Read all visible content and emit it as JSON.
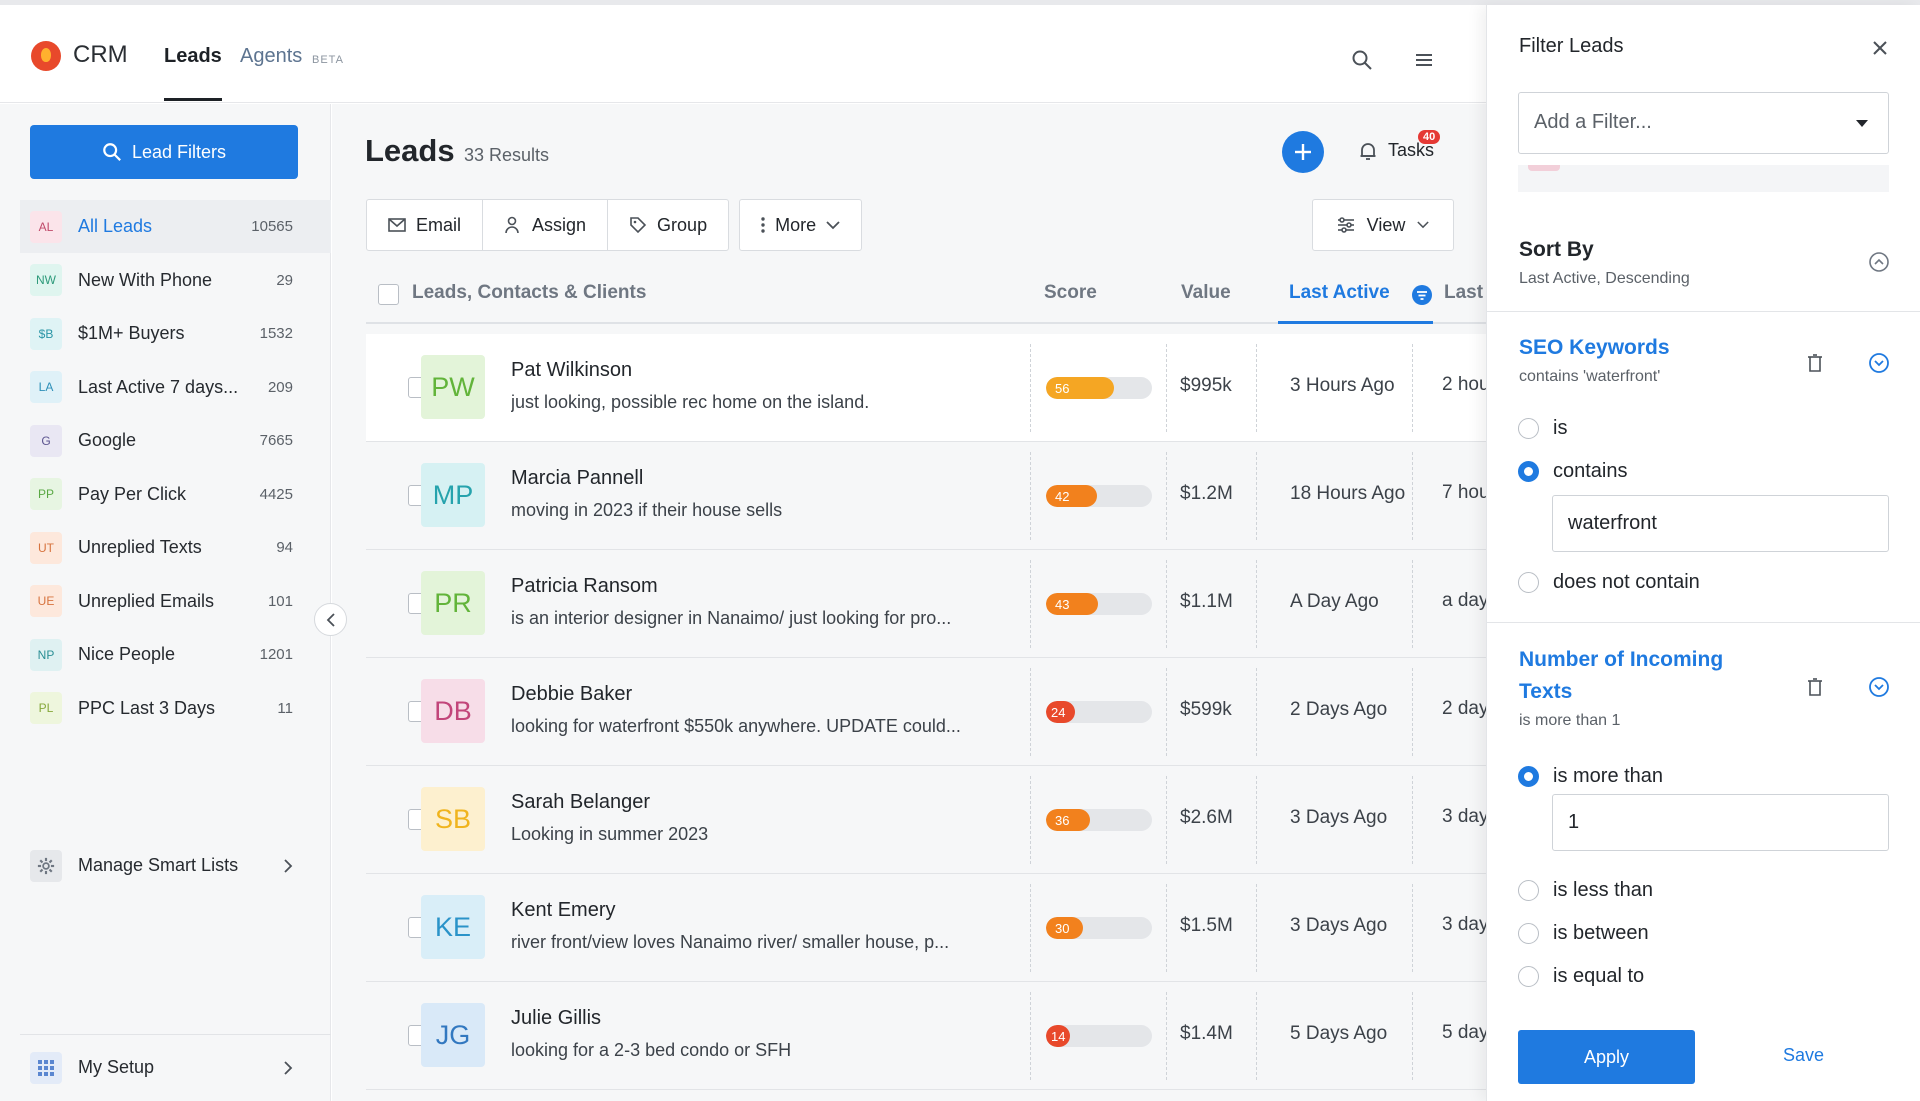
{
  "nav": {
    "brand": "CRM",
    "tabs": [
      {
        "label": "Leads"
      },
      {
        "label": "Agents"
      }
    ],
    "beta_label": "BETA",
    "accent_color": "#1f7ae0"
  },
  "sidebar": {
    "filter_button": "Lead Filters",
    "smart_lists": [
      {
        "badge": "AL",
        "label": "All Leads",
        "count": "10565",
        "badge_bg": "#fbe4ea",
        "badge_fg": "#c04a6a"
      },
      {
        "badge": "NW",
        "label": "New With Phone",
        "count": "29",
        "badge_bg": "#dff5ef",
        "badge_fg": "#2d9a7a"
      },
      {
        "badge": "$B",
        "label": "$1M+ Buyers",
        "count": "1532",
        "badge_bg": "#dff3f5",
        "badge_fg": "#2a95a6"
      },
      {
        "badge": "LA",
        "label": "Last Active 7 days...",
        "count": "209",
        "badge_bg": "#dff1f8",
        "badge_fg": "#2d8fb8"
      },
      {
        "badge": "G",
        "label": "Google",
        "count": "7665",
        "badge_bg": "#e9e7f3",
        "badge_fg": "#5d5690"
      },
      {
        "badge": "PP",
        "label": "Pay Per Click",
        "count": "4425",
        "badge_bg": "#e7f5e2",
        "badge_fg": "#5aa844"
      },
      {
        "badge": "UT",
        "label": "Unreplied Texts",
        "count": "94",
        "badge_bg": "#fde8dc",
        "badge_fg": "#d7733e"
      },
      {
        "badge": "UE",
        "label": "Unreplied Emails",
        "count": "101",
        "badge_bg": "#fde8dc",
        "badge_fg": "#d7733e"
      },
      {
        "badge": "NP",
        "label": "Nice People",
        "count": "1201",
        "badge_bg": "#dff1f2",
        "badge_fg": "#2b8f95"
      },
      {
        "badge": "PL",
        "label": "PPC Last 3 Days",
        "count": "11",
        "badge_bg": "#eef6dd",
        "badge_fg": "#86a83a"
      }
    ],
    "manage_label": "Manage Smart Lists",
    "setup_label": "My Setup"
  },
  "main": {
    "title": "Leads",
    "results": "33 Results",
    "tasks_label": "Tasks",
    "tasks_badge": "40",
    "toolbar": {
      "email": "Email",
      "assign": "Assign",
      "group": "Group",
      "more": "More",
      "view": "View"
    },
    "columns": {
      "name": "Leads, Contacts & Clients",
      "score": "Score",
      "value": "Value",
      "last_active": "Last Active",
      "last_touch": "Last Tou"
    },
    "leads": [
      {
        "initials": "PW",
        "name": "Pat Wilkinson",
        "note": "just looking, possible rec home on the island.",
        "score": 56,
        "score_color": "#f5a623",
        "value": "$995k",
        "last_active": "3 Hours Ago",
        "touch_icon": "chat-icon",
        "touch": "2 hou",
        "av_bg": "#e3f4d9",
        "av_fg": "#62b43a"
      },
      {
        "initials": "MP",
        "name": "Marcia Pannell",
        "note": "moving in 2023 if their house sells",
        "score": 42,
        "score_color": "#f2811d",
        "value": "$1.2M",
        "last_active": "18 Hours Ago",
        "touch_icon": "mail-icon",
        "touch": "7 hou",
        "av_bg": "#d6f1f3",
        "av_fg": "#26a3ad"
      },
      {
        "initials": "PR",
        "name": "Patricia Ransom",
        "note": "is an interior designer in Nanaimo/ just looking for pro...",
        "score": 43,
        "score_color": "#f2811d",
        "value": "$1.1M",
        "last_active": "A Day Ago",
        "touch_icon": "chat-icon",
        "touch": "a day",
        "av_bg": "#e3f4d9",
        "av_fg": "#62b43a"
      },
      {
        "initials": "DB",
        "name": "Debbie Baker",
        "note": "looking for waterfront $550k anywhere. UPDATE could...",
        "score": 24,
        "score_color": "#e8492b",
        "value": "$599k",
        "last_active": "2 Days Ago",
        "touch_icon": "mail-icon",
        "touch": "2 day",
        "av_bg": "#f7dde8",
        "av_fg": "#c2457a"
      },
      {
        "initials": "SB",
        "name": "Sarah Belanger",
        "note": "Looking in summer 2023",
        "score": 36,
        "score_color": "#f2811d",
        "value": "$2.6M",
        "last_active": "3 Days Ago",
        "touch_icon": "mail-icon",
        "touch": "3 day",
        "av_bg": "#fdf0cf",
        "av_fg": "#f0b41e"
      },
      {
        "initials": "KE",
        "name": "Kent Emery",
        "note": "river front/view loves Nanaimo river/ smaller house, p...",
        "score": 30,
        "score_color": "#f2811d",
        "value": "$1.5M",
        "last_active": "3 Days Ago",
        "touch_icon": "mail-icon",
        "touch": "3 day",
        "av_bg": "#d9eef8",
        "av_fg": "#2a93c9"
      },
      {
        "initials": "JG",
        "name": "Julie Gillis",
        "note": "looking for a 2-3 bed condo or SFH",
        "score": 14,
        "score_color": "#e8492b",
        "value": "$1.4M",
        "last_active": "5 Days Ago",
        "touch_icon": "mail-icon",
        "touch": "5 day",
        "av_bg": "#d9e9f8",
        "av_fg": "#3278c0"
      }
    ]
  },
  "panel": {
    "title": "Filter Leads",
    "add_filter_placeholder": "Add a Filter...",
    "sort_title": "Sort By",
    "sort_value": "Last Active, Descending",
    "seo": {
      "title": "SEO Keywords",
      "subtitle": "contains 'waterfront'",
      "options": [
        "is",
        "contains",
        "does not contain"
      ],
      "selected": "contains",
      "input_value": "waterfront"
    },
    "texts": {
      "title_line1": "Number of Incoming",
      "title_line2": "Texts",
      "subtitle": "is more than 1",
      "options": [
        "is more than",
        "is less than",
        "is between",
        "is equal to"
      ],
      "selected": "is more than",
      "input_value": "1"
    },
    "apply": "Apply",
    "save": "Save"
  }
}
